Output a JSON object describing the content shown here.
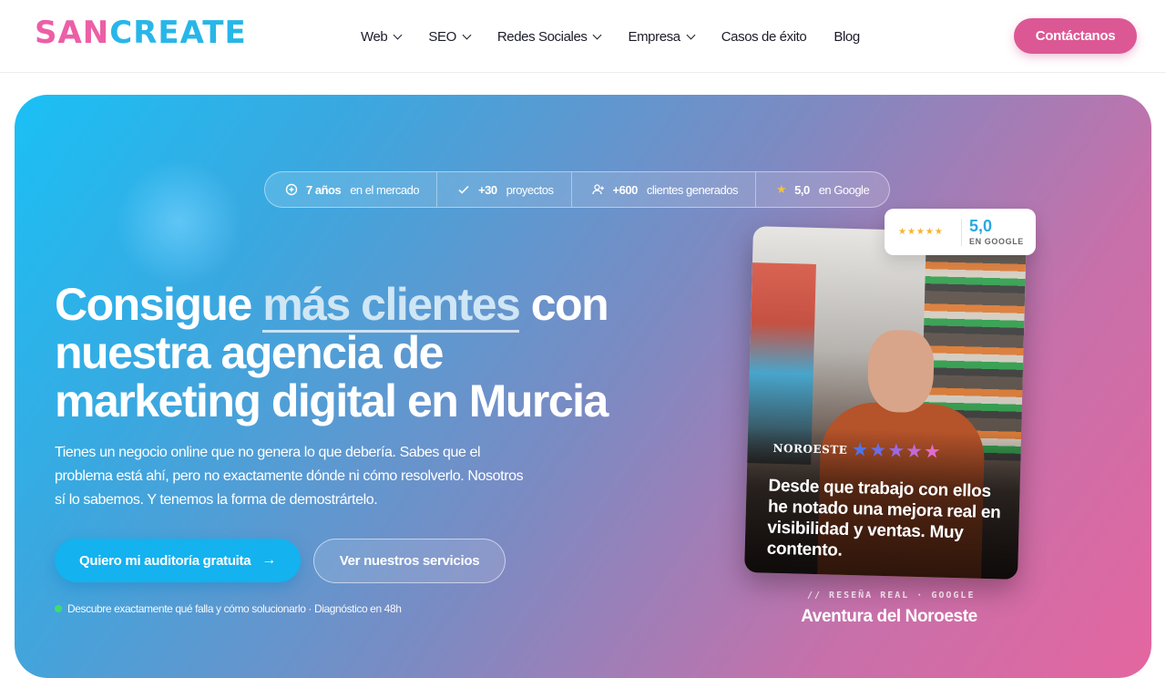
{
  "brand": {
    "logo_part1": "SAN",
    "logo_part2": "CREATE"
  },
  "nav": {
    "items": [
      {
        "label": "Web"
      },
      {
        "label": "SEO"
      },
      {
        "label": "Redes Sociales"
      },
      {
        "label": "Empresa"
      },
      {
        "label": "Casos de éxito"
      },
      {
        "label": "Blog"
      }
    ],
    "contact_label": "Contáctanos"
  },
  "stats": [
    {
      "icon": "target-icon",
      "number": "7 años",
      "label": "en el mercado"
    },
    {
      "icon": "check-icon",
      "number": "+30",
      "label": "proyectos"
    },
    {
      "icon": "user-plus-icon",
      "number": "+600",
      "label": "clientes generados"
    },
    {
      "icon": "star-icon",
      "number": "5,0",
      "label": "en Google"
    }
  ],
  "hero": {
    "headline_pre": "Consigue ",
    "headline_highlight": "más clientes",
    "headline_post": " con nuestra agencia de marketing digital en Murcia",
    "subtitle": "Tienes un negocio online que no genera lo que debería. Sabes que el problema está ahí, pero no exactamente dónde ni cómo resolverlo. Nosotros sí lo sabemos. Y tenemos la forma de demostrártelo.",
    "cta_primary": "Quiero mi auditoría gratuita",
    "cta_secondary": "Ver nuestros servicios",
    "note": "Descubre exactamente qué falla y cómo solucionarlo · Diagnóstico en 48h"
  },
  "testimonial": {
    "brand": "NOROESTE",
    "quote": "Desde que trabajo con ellos he notado una mejora real en visibilidad y ventas. Muy contento.",
    "stars": "★★★★★",
    "badge_stars": "★★★★★",
    "badge_score": "5,0",
    "badge_label": "EN GOOGLE",
    "tag": "// RESEÑA REAL · GOOGLE",
    "name": "Aventura del Noroeste"
  },
  "colors": {
    "accent_pink": "#dc5894",
    "accent_blue": "#14b2ee",
    "star": "#f5b52e"
  }
}
